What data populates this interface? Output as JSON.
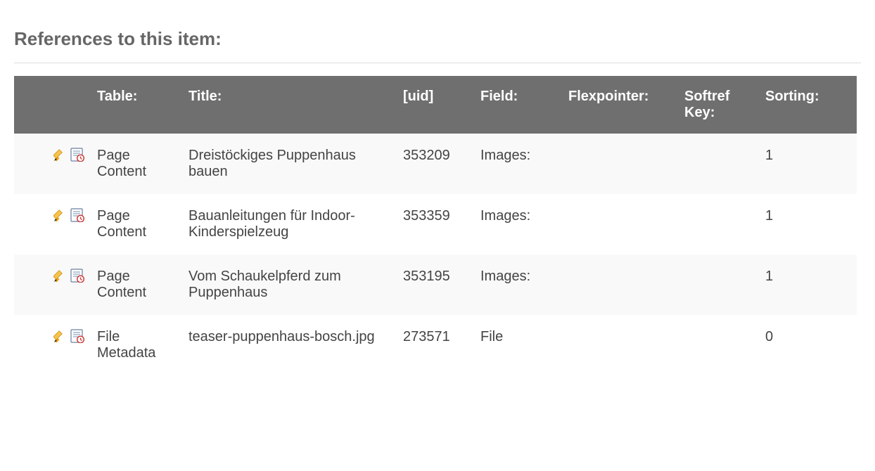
{
  "section_title": "References to this item:",
  "columns": {
    "table": "Table:",
    "title": "Title:",
    "uid": "[uid]",
    "field": "Field:",
    "flexpointer": "Flexpointer:",
    "softref": "Softref Key:",
    "sorting": "Sorting:"
  },
  "rows": [
    {
      "table": "Page Content",
      "title": "Dreistöckiges Puppenhaus bauen",
      "uid": "353209",
      "field": "Images:",
      "flexpointer": "",
      "softref": "",
      "sorting": "1"
    },
    {
      "table": "Page Content",
      "title": "Bauanleitungen für Indoor-Kinderspielzeug",
      "uid": "353359",
      "field": "Images:",
      "flexpointer": "",
      "softref": "",
      "sorting": "1"
    },
    {
      "table": "Page Content",
      "title": "Vom Schaukelpferd zum Puppenhaus",
      "uid": "353195",
      "field": "Images:",
      "flexpointer": "",
      "softref": "",
      "sorting": "1"
    },
    {
      "table": "File Metadata",
      "title": "teaser-puppenhaus-bosch.jpg",
      "uid": "273571",
      "field": "File",
      "flexpointer": "",
      "softref": "",
      "sorting": "0"
    }
  ]
}
